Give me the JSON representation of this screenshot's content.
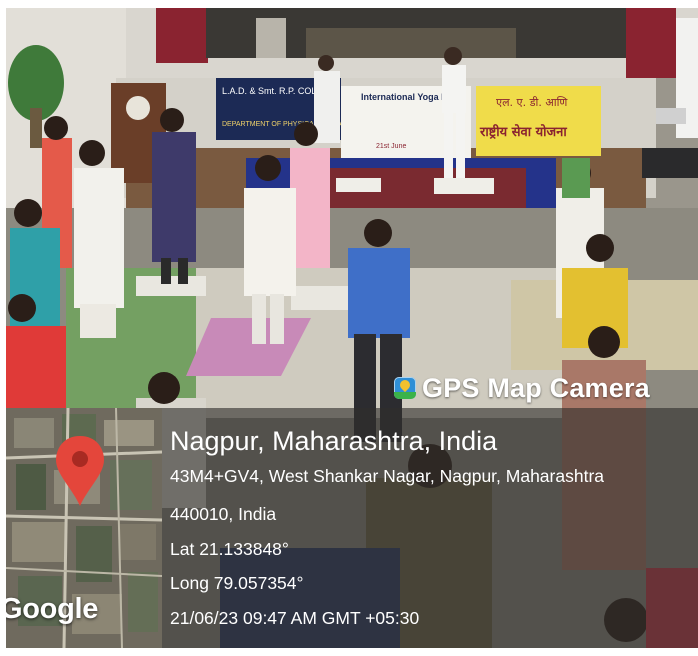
{
  "colors": {
    "overlay": "#302e2c",
    "text": "#ffffff",
    "pin": "#e4463b"
  },
  "watermark": {
    "app_name": "GPS Map Camera",
    "icon": "gps-map-camera-app-icon"
  },
  "location": {
    "title": "Nagpur, Maharashtra, India",
    "address_line_1": "43M4+GV4, West Shankar Nagar, Nagpur, Maharashtra",
    "address_line_2": "440010, India",
    "latitude": "Lat 21.133848°",
    "longitude": "Long 79.057354°",
    "datetime": "21/06/23 09:47 AM GMT +05:30"
  },
  "map": {
    "provider_mark": "Google",
    "pin_icon": "map-pin-icon"
  },
  "scene_text": {
    "banner_left": "L.A.D. & Smt. R.P. COLLEGE FOR WOMEN",
    "banner_left_sub": "DEPARTMENT OF PHYSICAL EDUCATION AND",
    "banner_center": "International Yoga Day",
    "banner_center_date": "21st June",
    "banner_right_1": "एल. ए. डी. आणि",
    "banner_right_2": "राष्ट्रीय सेवा योजना"
  }
}
